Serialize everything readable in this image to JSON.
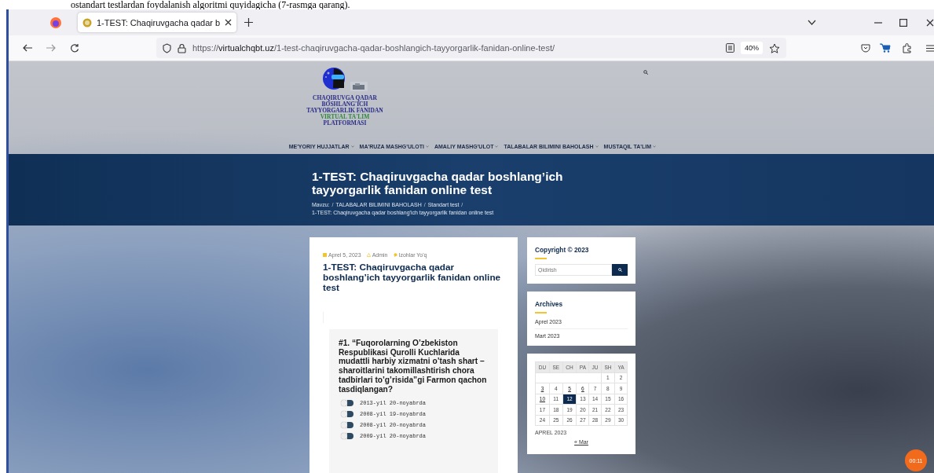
{
  "document_caption": "ostandart testlardan foydalanish algoritmi quyidagicha (7-rasmga qarang).",
  "browser": {
    "tabs": [
      {
        "title": "1-TEST: Chaqiruvgacha qadar b",
        "selected": true
      }
    ],
    "url": "https://**virtualchqbt.uz**/1-test-chaqiruvgacha-qadar-boshlangich-tayyorgarlik-fanidan-online-test/",
    "zoom": "40%"
  },
  "site_header": {
    "logo_lines": [
      {
        "text": "CHAQIRUVGA QADAR",
        "color": "#2a2a8a"
      },
      {
        "text": "BOSHLANG'ICH",
        "color": "#2a2a8a"
      },
      {
        "text": "TAYYORGARLIK FANIDAN",
        "color": "#2a2a8a"
      },
      {
        "text": "VIRTUAL TA'LIM",
        "color": "#2e8a3a"
      },
      {
        "text": "PLATFORMASI",
        "color": "#2a2a8a"
      }
    ],
    "nav": [
      "ME'YORIY HUJJATLAR",
      "MA'RUZA MASHG'ULOTI",
      "AMALIY MASHG'ULOT",
      "TALABALAR BILIMINI BAHOLASH",
      "MUSTAQIL TA'LIM"
    ]
  },
  "banner": {
    "title": "1-TEST: Chaqiruvgacha qadar boshlang’ich tayyorgarlik fanidan online test",
    "breadcrumb_separator": "/",
    "breadcrumb": [
      "Mavzu:",
      "TALABALAR BILIMINI BAHOLASH",
      "Standart test",
      "1-TEST: Chaqiruvgacha qadar boshlang'ich tayyorgarlik fanidan online test"
    ]
  },
  "post": {
    "date": "Aprel 5, 2023",
    "author": "Admin",
    "comments": "Izohlar Yo'q",
    "title": "1-TEST: Chaqiruvgacha qadar boshlang’ich tayyorgarlik fanidan online test",
    "question": "#1. “Fuqorolarning O’zbekiston Respublikasi Qurolli Kuchlarida mudattli harbiy xizmatni o’tash shart – sharoitlarini takomillashtirish chora tadbirlari to’g’risida”gi Farmon qachon tasdiqlangan?",
    "options": [
      {
        "label": "2013-yil 20-noyabrda",
        "selected": false
      },
      {
        "label": "2008-yil 19-noyabrda",
        "selected": false
      },
      {
        "label": "2008-yil 20-noyabrda",
        "selected": false
      },
      {
        "label": "2009-yil 20-noyabrda",
        "selected": false
      }
    ]
  },
  "sidebar": {
    "copyright_title": "Copyright © 2023",
    "search": {
      "placeholder": "Qidirish"
    },
    "archives_title": "Archives",
    "archives": [
      "Aprel 2023",
      "Mart 2023"
    ],
    "calendar": {
      "weekdays": [
        "DU",
        "SE",
        "CH",
        "PA",
        "JU",
        "SH",
        "YA"
      ],
      "weeks": [
        [
          {
            "day": "1",
            "linked": false,
            "today": false
          },
          {
            "day": "2",
            "linked": false,
            "today": false
          }
        ],
        [
          {
            "day": "3",
            "linked": true,
            "today": false
          },
          {
            "day": "4",
            "linked": false,
            "today": false
          },
          {
            "day": "5",
            "linked": true,
            "today": false
          },
          {
            "day": "6",
            "linked": true,
            "today": false
          },
          {
            "day": "7",
            "linked": false,
            "today": false
          },
          {
            "day": "8",
            "linked": false,
            "today": false
          },
          {
            "day": "9",
            "linked": false,
            "today": false
          }
        ],
        [
          {
            "day": "10",
            "linked": true,
            "today": false
          },
          {
            "day": "11",
            "linked": false,
            "today": false
          },
          {
            "day": "12",
            "linked": false,
            "today": true
          },
          {
            "day": "13",
            "linked": false,
            "today": false
          },
          {
            "day": "14",
            "linked": false,
            "today": false
          },
          {
            "day": "15",
            "linked": false,
            "today": false
          },
          {
            "day": "16",
            "linked": false,
            "today": false
          }
        ],
        [
          {
            "day": "17",
            "linked": false,
            "today": false
          },
          {
            "day": "18",
            "linked": false,
            "today": false
          },
          {
            "day": "19",
            "linked": false,
            "today": false
          },
          {
            "day": "20",
            "linked": false,
            "today": false
          },
          {
            "day": "21",
            "linked": false,
            "today": false
          },
          {
            "day": "22",
            "linked": false,
            "today": false
          },
          {
            "day": "23",
            "linked": false,
            "today": false
          }
        ],
        [
          {
            "day": "24",
            "linked": false,
            "today": false
          },
          {
            "day": "25",
            "linked": false,
            "today": false
          },
          {
            "day": "26",
            "linked": false,
            "today": false
          },
          {
            "day": "27",
            "linked": false,
            "today": false
          },
          {
            "day": "28",
            "linked": false,
            "today": false
          },
          {
            "day": "29",
            "linked": false,
            "today": false
          },
          {
            "day": "30",
            "linked": false,
            "today": false
          }
        ]
      ],
      "caption": "APREL 2023",
      "prev": "« Mar"
    }
  },
  "timer": "00:11"
}
